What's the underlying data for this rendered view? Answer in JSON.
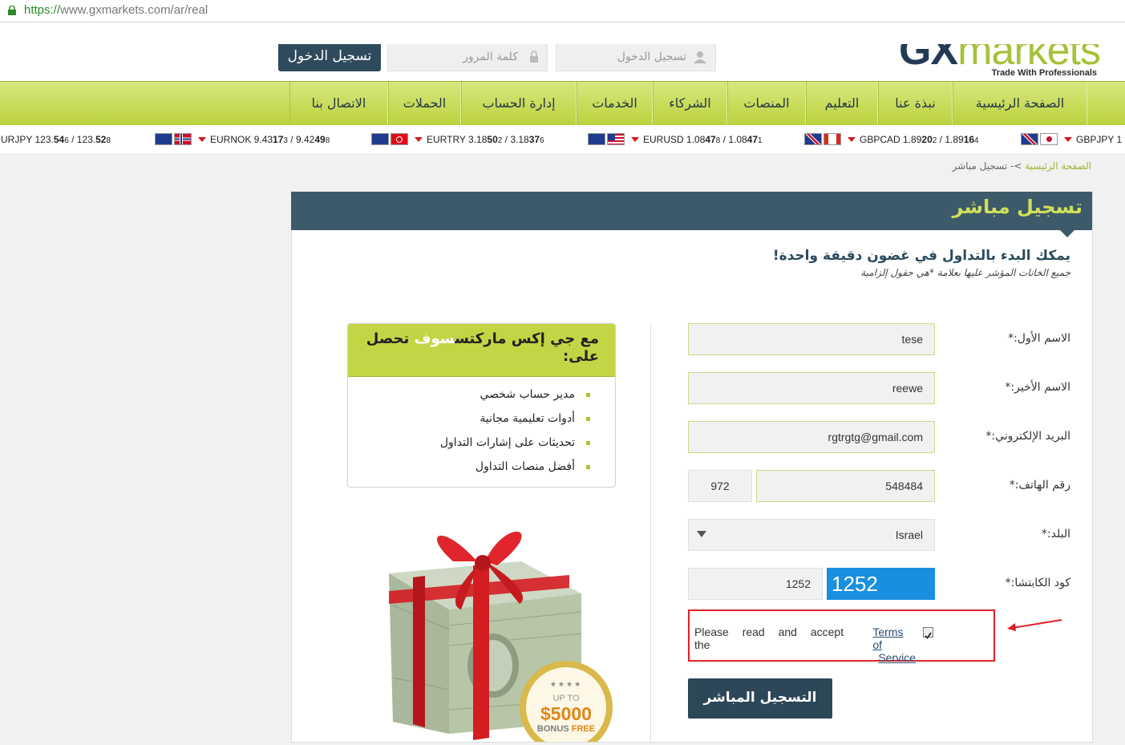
{
  "browser": {
    "url_protocol": "https://",
    "url_rest": "www.gxmarkets.com/ar/real"
  },
  "header": {
    "login_button": "تسجيل الدخول",
    "password_placeholder": "كلمة المرور",
    "username_placeholder": "تسجيل الدخول",
    "logo_text_gx": "GX",
    "logo_text_markets": "markets",
    "logo_tagline": "Trade With Professionals"
  },
  "nav": {
    "items": [
      "الصفحة الرئيسية",
      "نبذة عنا",
      "التعليم",
      "المنصات",
      "الشركاء",
      "الخدمات",
      "إدارة الحساب",
      "الحملات",
      "الاتصال بنا"
    ]
  },
  "ticker": {
    "items": [
      {
        "pair": "GBPJPY",
        "bid_a": "1",
        "bid_b": "",
        "bid_c": "",
        "ask_a": "",
        "ask_b": "",
        "ask_c": "",
        "full": "GBPJPY 1(cut)"
      },
      {
        "pair": "GBPCAD",
        "full": "GBPCAD"
      },
      {
        "pair": "EURUSD",
        "full": "EURUSD"
      },
      {
        "pair": "EURTRY",
        "full": "EURTRY"
      },
      {
        "pair": "EURNOK",
        "full": "EURNOK"
      },
      {
        "pair": "EURJPY",
        "full": "EURJPY"
      }
    ],
    "gbpjpy": {
      "pair": "GBPJPY",
      "value": "1"
    },
    "gbpcad": {
      "pair": "GBPCAD",
      "bid_main": "1.89",
      "bid_big": "20",
      "bid_small": "2",
      "ask_main": "1.89",
      "ask_big": "16",
      "ask_small": "4"
    },
    "eurusd": {
      "pair": "EURUSD",
      "bid_main": "1.08",
      "bid_big": "47",
      "bid_small": "8",
      "ask_main": "1.08",
      "ask_big": "47",
      "ask_small": "1"
    },
    "eurtry": {
      "pair": "EURTRY",
      "bid_main": "3.18",
      "bid_big": "50",
      "bid_small": "2",
      "ask_main": "3.18",
      "ask_big": "37",
      "ask_small": "6"
    },
    "eurnok": {
      "pair": "EURNOK",
      "bid_main": "9.43",
      "bid_big": "17",
      "bid_small": "3",
      "ask_main": "9.42",
      "ask_big": "49",
      "ask_small": "8"
    },
    "eurjpy": {
      "pair": "URJPY",
      "bid_main": "123.",
      "bid_big": "54",
      "bid_small": "6",
      "ask_main": "123.",
      "ask_big": "52",
      "ask_small": "8"
    },
    "separator": " / "
  },
  "breadcrumb": {
    "home": "الصفحة الرئيسية",
    "sep": " >- ",
    "current": "تسجيل مباشر"
  },
  "card": {
    "title": "تسجيل مباشر",
    "intro_heading": "يمكك البدء بالتداول في غضون دقيقة واحدة!",
    "intro_sub": "جميع الخانات المؤشر عليها بعلامة *هي حقول إلزامية"
  },
  "form": {
    "first_name_label": "الاسم الأول:*",
    "first_name_value": "tese",
    "last_name_label": "الاسم الأخير:*",
    "last_name_value": "reewe",
    "email_label": "البريد الإلكتروني:*",
    "email_value": "rgtrgtg@gmail.com",
    "phone_label": "رقم الهاتف:*",
    "phone_code": "972",
    "phone_value": "548484",
    "country_label": "البلد:*",
    "country_value": "Israel",
    "captcha_label": "كود الكابتشا:*",
    "captcha_value": "1252",
    "captcha_image_text": "1252",
    "tos_line1": "Please read and accept the",
    "tos_link_part1": "Terms of",
    "tos_link_part2": "Service",
    "tos_checked": true,
    "submit_label": "التسجيل المباشر"
  },
  "benefits": {
    "title_part1": "مع جي ",
    "title_brand": "إكس ماركتس",
    "title_part2": "سوف",
    "title_part3": " تحصل على:",
    "items": [
      "مدير حساب شخصي",
      "أدوات تعليمية مجانية",
      "تحديثات على إشارات التداول",
      "أفضل منصات التداول"
    ]
  },
  "gift": {
    "stars": "★★★★",
    "upto": "UP TO",
    "amount": "$5000",
    "bonus": "BONUS",
    "free": "FREE"
  },
  "colors": {
    "accent_green": "#bcd23d",
    "dark_teal": "#3d5a6b",
    "highlight_red": "#e3202a",
    "captcha_blue": "#1a8fe0"
  }
}
